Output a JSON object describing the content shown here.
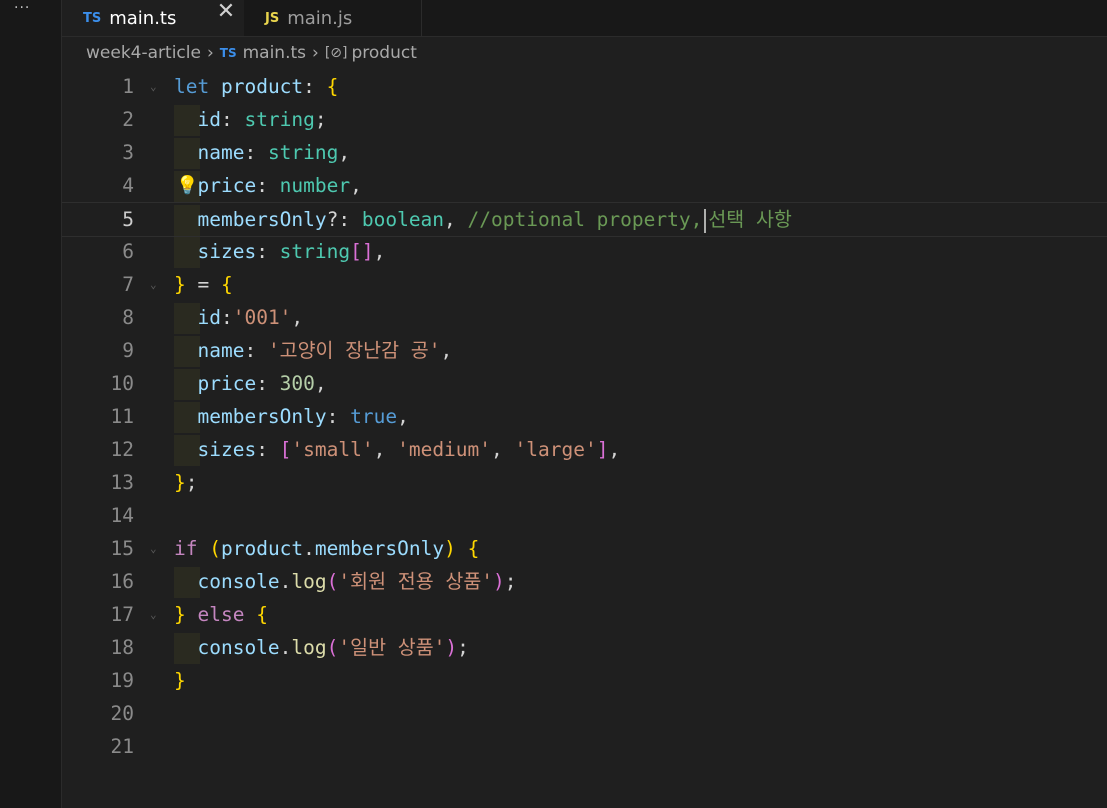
{
  "activity": {
    "more_label": "···"
  },
  "tabs": [
    {
      "icon": "TS",
      "label": "main.ts",
      "active": true,
      "close": "✕"
    },
    {
      "icon": "JS",
      "label": "main.js",
      "active": false
    }
  ],
  "breadcrumb": {
    "folder": "week4-article",
    "file_icon": "TS",
    "file": "main.ts",
    "symbol_icon": "[⊘]",
    "symbol": "product"
  },
  "editor": {
    "current_line": 5,
    "line_numbers": [
      "1",
      "2",
      "3",
      "4",
      "5",
      "6",
      "7",
      "8",
      "9",
      "10",
      "11",
      "12",
      "13",
      "14",
      "15",
      "16",
      "17",
      "18",
      "19",
      "20",
      "21"
    ],
    "lines": [
      [
        [
          "let",
          "k"
        ],
        [
          " ",
          "p"
        ],
        [
          "product",
          "v"
        ],
        [
          ": ",
          "p"
        ],
        [
          "{",
          "b1"
        ]
      ],
      [
        [
          "  ",
          "p"
        ],
        [
          "id",
          "v"
        ],
        [
          ": ",
          "p"
        ],
        [
          "string",
          "t"
        ],
        [
          ";",
          "p"
        ]
      ],
      [
        [
          "  ",
          "p"
        ],
        [
          "name",
          "v"
        ],
        [
          ": ",
          "p"
        ],
        [
          "string",
          "t"
        ],
        [
          ",",
          "p"
        ]
      ],
      [
        [
          "  ",
          "p"
        ],
        [
          "price",
          "v"
        ],
        [
          ": ",
          "p"
        ],
        [
          "number",
          "t"
        ],
        [
          ",",
          "p"
        ]
      ],
      [
        [
          "  ",
          "p"
        ],
        [
          "membersOnly",
          "v"
        ],
        [
          "?: ",
          "p"
        ],
        [
          "boolean",
          "t"
        ],
        [
          ", ",
          "p"
        ],
        [
          "//optional property,",
          "c"
        ],
        [
          "|CURSOR|",
          "cursor"
        ],
        [
          "선택 사항",
          "c"
        ]
      ],
      [
        [
          "  ",
          "p"
        ],
        [
          "sizes",
          "v"
        ],
        [
          ": ",
          "p"
        ],
        [
          "string",
          "t"
        ],
        [
          "[]",
          "b2"
        ],
        [
          ",",
          "p"
        ]
      ],
      [
        [
          "}",
          "b1"
        ],
        [
          " = ",
          "p"
        ],
        [
          "{",
          "b1"
        ]
      ],
      [
        [
          "  ",
          "p"
        ],
        [
          "id",
          "v"
        ],
        [
          ":",
          "p"
        ],
        [
          "'001'",
          "s"
        ],
        [
          ",",
          "p"
        ]
      ],
      [
        [
          "  ",
          "p"
        ],
        [
          "name",
          "v"
        ],
        [
          ": ",
          "p"
        ],
        [
          "'고양이 장난감 공'",
          "s"
        ],
        [
          ",",
          "p"
        ]
      ],
      [
        [
          "  ",
          "p"
        ],
        [
          "price",
          "v"
        ],
        [
          ": ",
          "p"
        ],
        [
          "300",
          "n"
        ],
        [
          ",",
          "p"
        ]
      ],
      [
        [
          "  ",
          "p"
        ],
        [
          "membersOnly",
          "v"
        ],
        [
          ": ",
          "p"
        ],
        [
          "true",
          "k"
        ],
        [
          ",",
          "p"
        ]
      ],
      [
        [
          "  ",
          "p"
        ],
        [
          "sizes",
          "v"
        ],
        [
          ": ",
          "p"
        ],
        [
          "[",
          "b2"
        ],
        [
          "'small'",
          "s"
        ],
        [
          ", ",
          "p"
        ],
        [
          "'medium'",
          "s"
        ],
        [
          ", ",
          "p"
        ],
        [
          "'large'",
          "s"
        ],
        [
          "]",
          "b2"
        ],
        [
          ",",
          "p"
        ]
      ],
      [
        [
          "}",
          "b1"
        ],
        [
          ";",
          "p"
        ]
      ],
      [],
      [
        [
          "if",
          "ctrl"
        ],
        [
          " ",
          "p"
        ],
        [
          "(",
          "b1"
        ],
        [
          "product",
          "v"
        ],
        [
          ".",
          "p"
        ],
        [
          "membersOnly",
          "v"
        ],
        [
          ")",
          "b1"
        ],
        [
          " ",
          "p"
        ],
        [
          "{",
          "b1"
        ]
      ],
      [
        [
          "  ",
          "p"
        ],
        [
          "console",
          "v"
        ],
        [
          ".",
          "p"
        ],
        [
          "log",
          "f"
        ],
        [
          "(",
          "b2"
        ],
        [
          "'회원 전용 상품'",
          "s"
        ],
        [
          ")",
          "b2"
        ],
        [
          ";",
          "p"
        ]
      ],
      [
        [
          "}",
          "b1"
        ],
        [
          " ",
          "p"
        ],
        [
          "else",
          "ctrl"
        ],
        [
          " ",
          "p"
        ],
        [
          "{",
          "b1"
        ]
      ],
      [
        [
          "  ",
          "p"
        ],
        [
          "console",
          "v"
        ],
        [
          ".",
          "p"
        ],
        [
          "log",
          "f"
        ],
        [
          "(",
          "b2"
        ],
        [
          "'일반 상품'",
          "s"
        ],
        [
          ")",
          "b2"
        ],
        [
          ";",
          "p"
        ]
      ],
      [
        [
          "}",
          "b1"
        ]
      ],
      [],
      []
    ]
  }
}
